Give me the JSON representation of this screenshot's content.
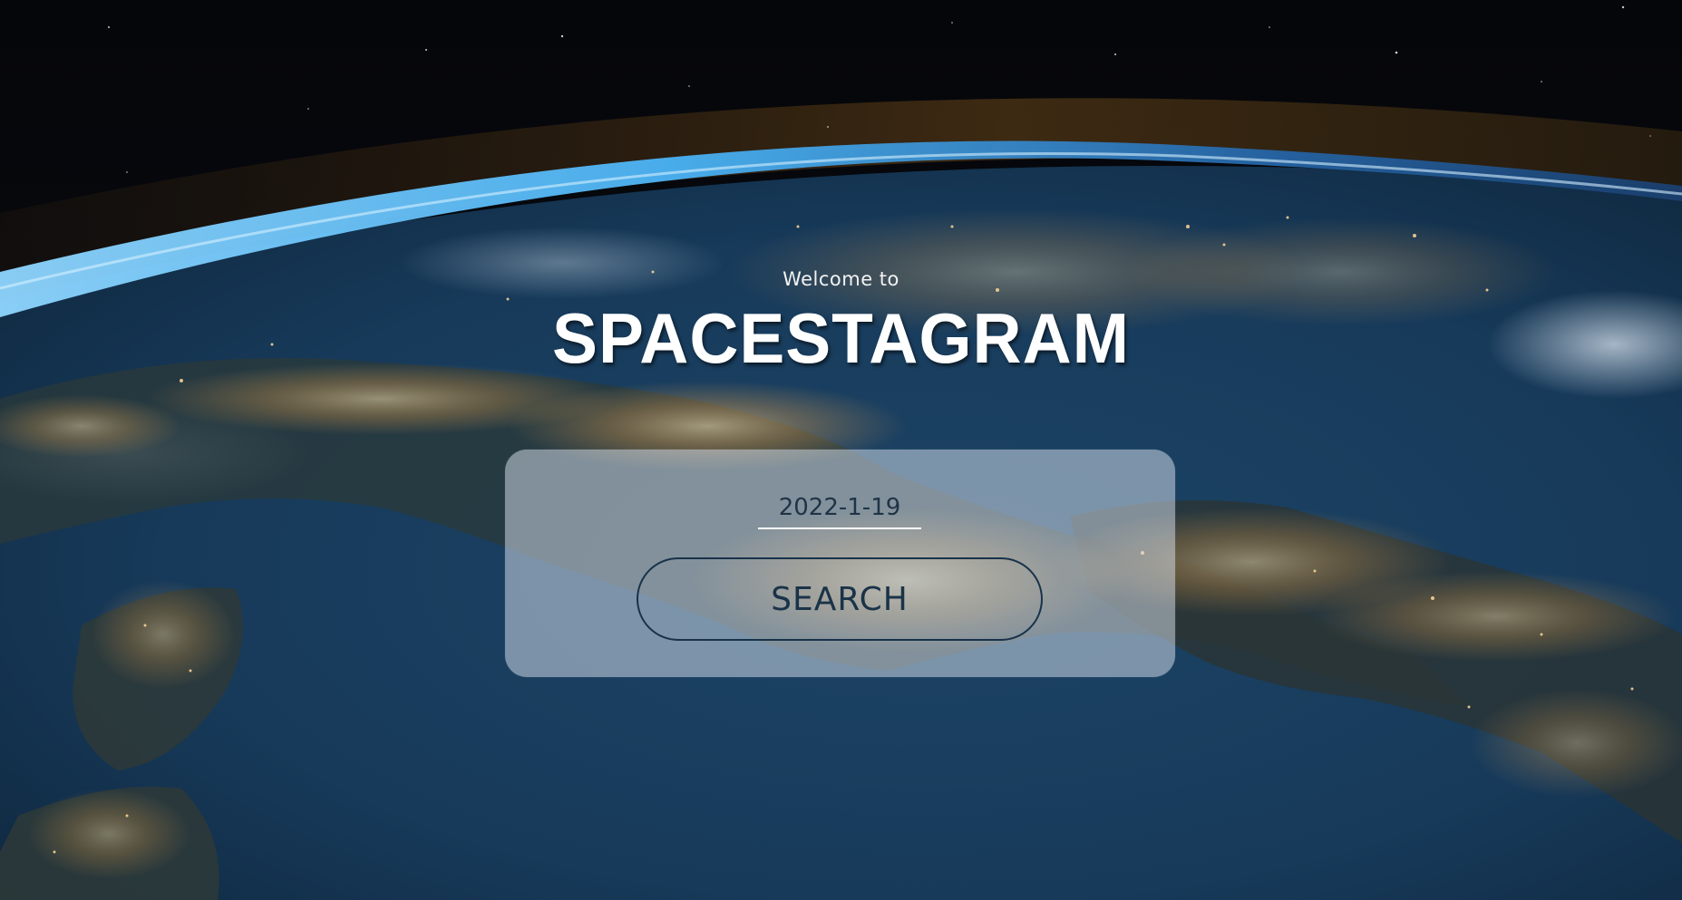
{
  "hero": {
    "welcome_text": "Welcome to",
    "title": "SPACESTAGRAM"
  },
  "search_form": {
    "date_value": "2022-1-19",
    "search_label": "SEARCH"
  },
  "colors": {
    "space": "#05070d",
    "ocean": "#123350",
    "atmosphere": "#5fc4ff",
    "city_lights": "#ffcf7a",
    "card": "#d7e1eb",
    "button_text": "#1a3348"
  }
}
